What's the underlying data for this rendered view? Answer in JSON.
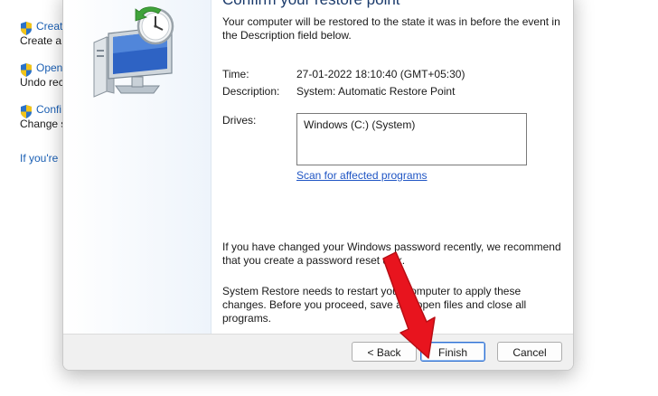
{
  "background": {
    "items": [
      {
        "icon": "uac-shield-icon",
        "link": "Creat",
        "sub": "Create a"
      },
      {
        "icon": "uac-shield-icon",
        "link": "Open",
        "sub": "Undo rec"
      },
      {
        "icon": "uac-shield-icon",
        "link": "Confi",
        "sub": "Change s"
      }
    ],
    "help_link": "If you're"
  },
  "dialog": {
    "heading": "Confirm your restore point",
    "intro": "Your computer will be restored to the state it was in before the event in the Description field below.",
    "time_label": "Time:",
    "time_value": "27-01-2022 18:10:40 (GMT+05:30)",
    "description_label": "Description:",
    "description_value": "System: Automatic Restore Point",
    "drives_label": "Drives:",
    "drives": [
      "Windows (C:) (System)"
    ],
    "scan_link": "Scan for affected programs",
    "password_note": "If you have changed your Windows password recently, we recommend that you create a password reset disk.",
    "restart_note": "System Restore needs to restart your computer to apply these changes. Before you proceed, save any open files and close all programs.",
    "buttons": {
      "back": "< Back",
      "finish": "Finish",
      "cancel": "Cancel"
    }
  },
  "colors": {
    "link": "#1a5fb4",
    "heading": "#1a3a6b",
    "annotation_arrow": "#e8141e",
    "primary_button_border": "#2f6fd0"
  }
}
